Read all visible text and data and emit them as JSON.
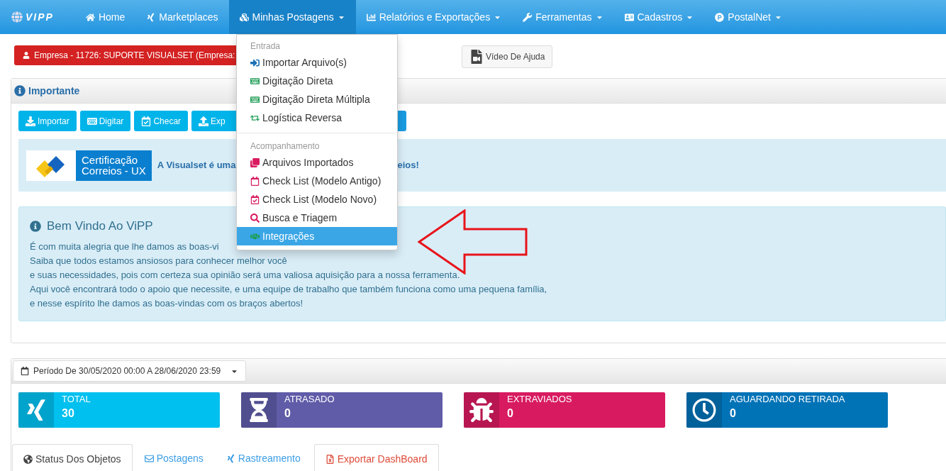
{
  "nav": {
    "logo": "VIPP",
    "items": [
      {
        "label": "Home",
        "selected": false,
        "dropdown": false
      },
      {
        "label": "Marketplaces",
        "selected": false,
        "dropdown": false
      },
      {
        "label": "Minhas Postagens",
        "selected": true,
        "dropdown": true
      },
      {
        "label": "Relatórios e Exportações",
        "selected": false,
        "dropdown": true
      },
      {
        "label": "Ferramentas",
        "selected": false,
        "dropdown": true
      },
      {
        "label": "Cadastros",
        "selected": false,
        "dropdown": true
      },
      {
        "label": "PostalNet",
        "selected": false,
        "dropdown": true
      }
    ]
  },
  "company_label": "Empresa - 11726: SUPORTE VISUALSET (Empresa:",
  "help_button": "Vídeo De Ajuda",
  "panel": {
    "title": "Importante",
    "toolbar": [
      "Importar",
      "Digitar",
      "Checar",
      "Exp"
    ],
    "banner": {
      "logo_lines": [
        "Certificação",
        "Correios - UX"
      ],
      "text_before": "A Visualset é uma",
      "text_after": "eios!"
    },
    "welcome": {
      "title": "Bem Vindo Ao ViPP",
      "lines": [
        "É com muita alegria que lhe damos as boas-vi",
        "Saiba que todos estamos ansiosos para conhecer melhor você",
        "e suas necessidades, pois com certeza sua opinião será uma valiosa aquisição para a nossa ferramenta.",
        "Aqui você encontrará todo o apoio que necessite, e uma equipe de trabalho que também funciona como uma pequena família,",
        "e nesse espírito lhe damos as boas-vindas com os braços abertos!"
      ]
    }
  },
  "menu": {
    "sections": [
      {
        "header": "Entrada",
        "items": [
          {
            "label": "Importar Arquivo(s)",
            "selected": false
          },
          {
            "label": "Digitação Direta",
            "selected": false
          },
          {
            "label": "Digitação Direta Múltipla",
            "selected": false
          },
          {
            "label": "Logística Reversa",
            "selected": false
          }
        ]
      },
      {
        "header": "Acompanhamento",
        "items": [
          {
            "label": "Arquivos Importados",
            "selected": false
          },
          {
            "label": "Check List (Modelo Antigo)",
            "selected": false
          },
          {
            "label": "Check List (Modelo Novo)",
            "selected": false
          },
          {
            "label": "Busca e Triagem",
            "selected": false
          },
          {
            "label": "Integrações",
            "selected": true
          }
        ]
      }
    ]
  },
  "dashboard": {
    "period": "Período De 30/05/2020 00:00 A 28/06/2020 23:59",
    "cards": [
      {
        "label": "TOTAL",
        "value": "30",
        "color": "#00c0ef"
      },
      {
        "label": "ATRASADO",
        "value": "0",
        "color": "#605ca8"
      },
      {
        "label": "EXTRAVIADOS",
        "value": "0",
        "color": "#d81b60"
      },
      {
        "label": "AGUARDANDO RETIRADA",
        "value": "0",
        "color": "#0073b7"
      }
    ],
    "tabs": [
      {
        "label": "Status Dos Objetos",
        "selected": true,
        "kind": "normal"
      },
      {
        "label": "Postagens",
        "selected": false,
        "kind": "normal"
      },
      {
        "label": "Rastreamento",
        "selected": false,
        "kind": "normal"
      },
      {
        "label": "Exportar DashBoard",
        "selected": false,
        "kind": "export"
      }
    ]
  }
}
